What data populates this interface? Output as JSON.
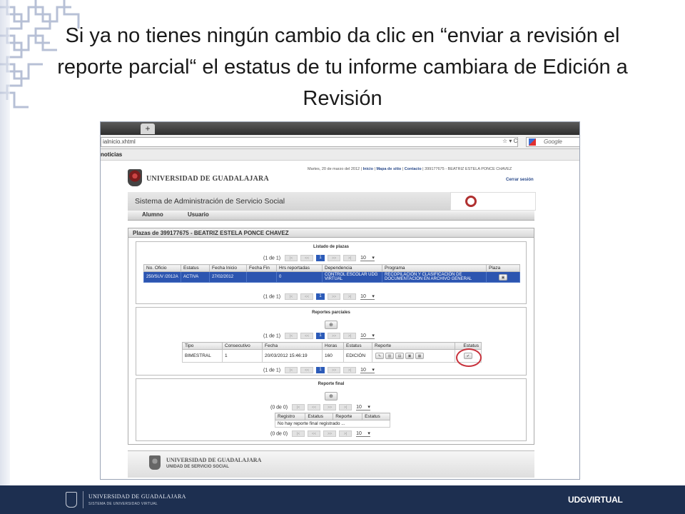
{
  "slide": {
    "title": "Si ya no tienes ningún cambio da clic en “enviar a revisión el reporte parcial“  el estatus de tu informe cambiara de Edición a Revisión"
  },
  "browser": {
    "new_tab_label": "+",
    "url": "ialnicio.xhtml",
    "search_placeholder": "Google",
    "bookmark": "noticias"
  },
  "site": {
    "date_text": "Martes, 20 de marzo del 2012",
    "links": [
      "Inicio",
      "Mapa de sitio",
      "Contacto"
    ],
    "user_text": "399177675 - BEATRIZ ESTELA PONCE CHAVEZ",
    "logout": "Cerrar sesión",
    "university": "UNIVERSIDAD DE GUADALAJARA",
    "system_title": "Sistema de Administración de Servicio Social",
    "menu": [
      "Alumno",
      "Usuario"
    ],
    "panel_title": "Plazas de 399177675 - BEATRIZ ESTELA PONCE CHAVEZ"
  },
  "plazas": {
    "title": "Listado de plazas",
    "pager": {
      "info": "(1 de 1)",
      "current": "1",
      "rows": "10"
    },
    "headers": [
      "No. Oficio",
      "Estatus",
      "Fecha Inicio",
      "Fecha Fin",
      "Hrs reportadas",
      "Dependencia",
      "Programa",
      "Plaza"
    ],
    "row": {
      "oficio": "250/SUV /2012A",
      "estatus": "ACTIVA",
      "inicio": "27/02/2012",
      "fin": "",
      "horas": "0",
      "dependencia": "CONTROL ESCOLAR UDG VIRTUAL",
      "programa": "RECOPILACIÓN Y CLASIFICACIÓN DE DOCUMENTACIÓN EN ARCHIVO GENERAL"
    }
  },
  "parciales": {
    "title": "Reportes parciales",
    "pager": {
      "info": "(1 de 1)",
      "current": "1",
      "rows": "10"
    },
    "headers": [
      "Tipo",
      "Consecutivo",
      "Fecha",
      "Horas",
      "Estatus",
      "Reporte",
      "Estatus"
    ],
    "row": {
      "tipo": "BIMESTRAL",
      "consecutivo": "1",
      "fecha": "20/03/2012 15:46:19",
      "horas": "160",
      "estatus": "EDICIÓN"
    }
  },
  "final": {
    "title": "Reporte final",
    "pager": {
      "info": "(0 de 0)",
      "rows": "10"
    },
    "headers": [
      "Registro",
      "Estatus",
      "Reporte",
      "Estatus"
    ],
    "empty": "No hay reporte final registrado ..."
  },
  "footer": {
    "university": "UNIVERSIDAD DE GUADALAJARA",
    "unit": "UNIDAD DE SERVICIO SOCIAL"
  },
  "band": {
    "university": "UNIVERSIDAD DE GUADALAJARA",
    "system": "SISTEMA DE UNIVERSIDAD VIRTUAL",
    "brand": "UDGVIRTUAL"
  },
  "colors": {
    "highlight_row": "#2c55b0",
    "accent_circle": "#c8323c",
    "band": "#1d2f50"
  }
}
